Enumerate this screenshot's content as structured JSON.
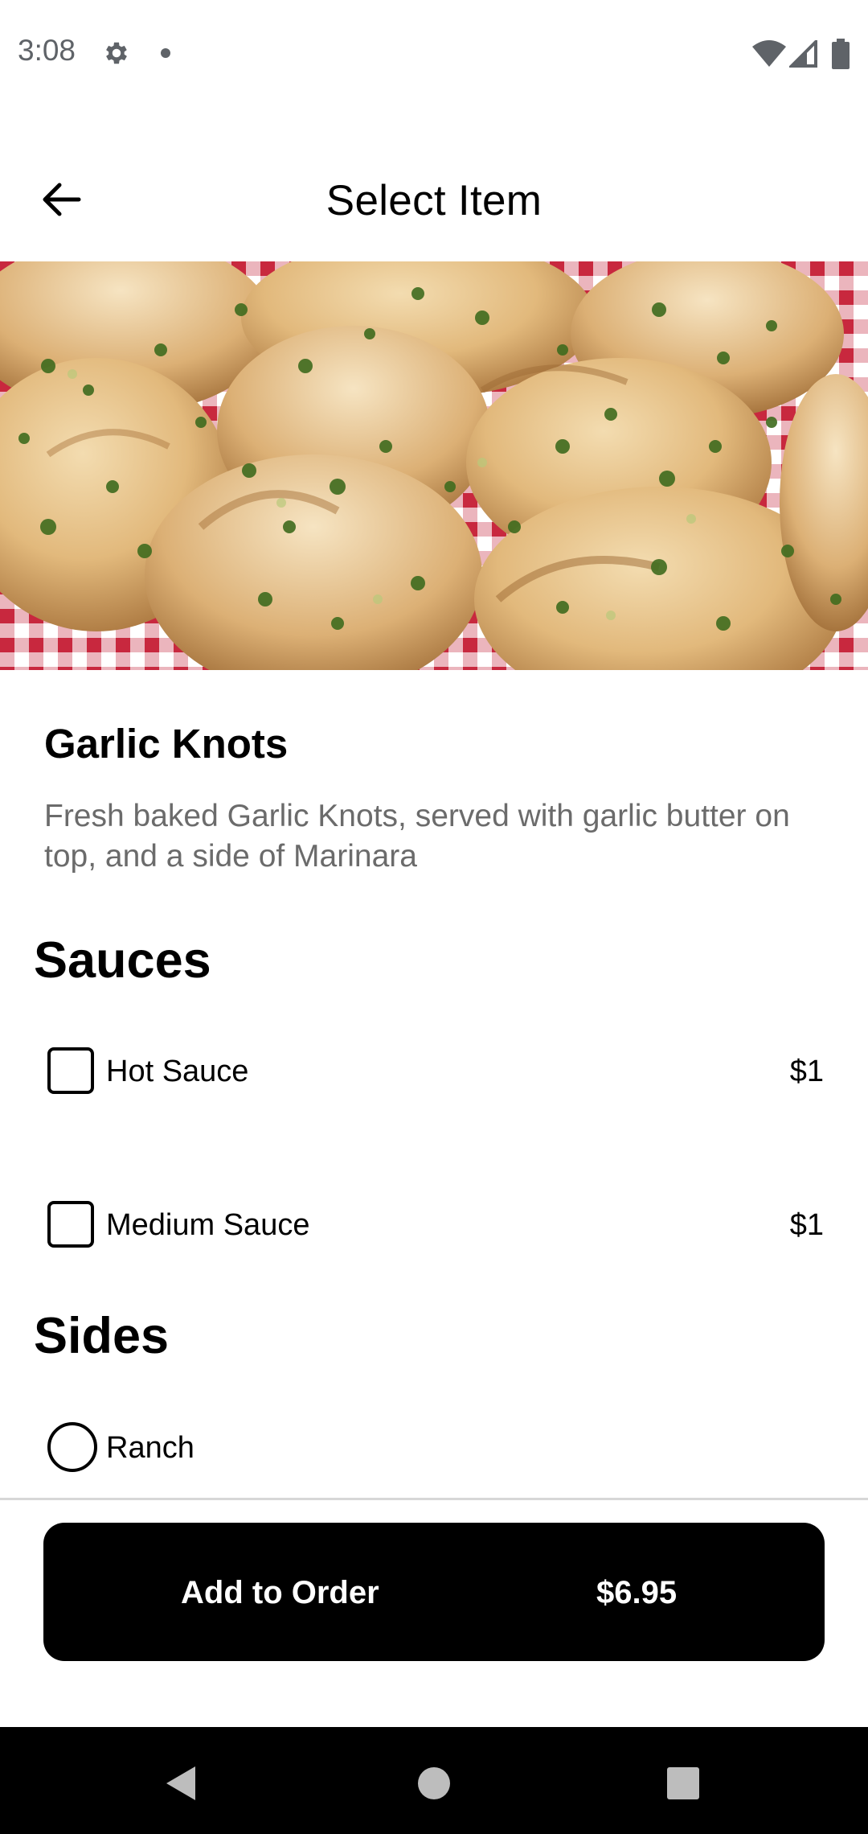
{
  "status_bar": {
    "time": "3:08",
    "icons": [
      "gear-icon",
      "notification-dot-icon",
      "wifi-icon",
      "cell-signal-icon",
      "battery-icon"
    ]
  },
  "app_bar": {
    "back_icon": "arrow-left-icon",
    "title": "Select Item"
  },
  "item": {
    "image": "garlic-knots-photo",
    "name": "Garlic Knots",
    "description": "Fresh baked Garlic Knots, served with garlic butter on top, and a side of Marinara"
  },
  "sections": [
    {
      "title": "Sauces",
      "type": "checkbox",
      "options": [
        {
          "label": "Hot Sauce",
          "price": "$1",
          "checked": false
        },
        {
          "label": "Medium Sauce",
          "price": "$1",
          "checked": false
        }
      ]
    },
    {
      "title": "Sides",
      "type": "radio",
      "options": [
        {
          "label": "Ranch",
          "selected": false
        }
      ]
    }
  ],
  "footer": {
    "add_label": "Add to Order",
    "total": "$6.95"
  },
  "nav_bar": {
    "icons": [
      "nav-back-icon",
      "nav-home-icon",
      "nav-recents-icon"
    ]
  },
  "colors": {
    "accent": "#000000",
    "description_text": "#6b6b6b",
    "status_text": "#5f6368",
    "divider": "#d7d7d7"
  }
}
